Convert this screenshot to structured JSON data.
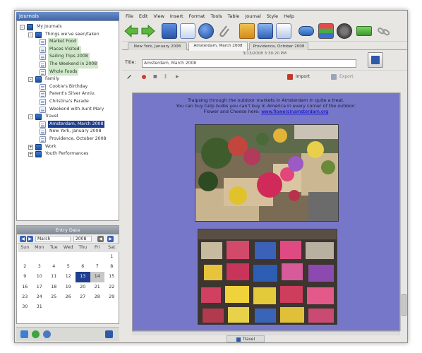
{
  "sidebar": {
    "title": "Journals",
    "tree": [
      {
        "label": "My Journals",
        "depth": 0,
        "icon": "folder-icon",
        "expander": "-"
      },
      {
        "label": "Things we've seen/taken",
        "depth": 1,
        "icon": "journal-book-icon",
        "expander": "-"
      },
      {
        "label": "Market Food",
        "depth": 2,
        "icon": "entry-page-icon",
        "style": "green"
      },
      {
        "label": "Places Visited",
        "depth": 2,
        "icon": "entry-page-icon",
        "style": "green"
      },
      {
        "label": "Sailing Trips 2008",
        "depth": 2,
        "icon": "entry-page-icon",
        "style": "green"
      },
      {
        "label": "The Weekend in 2008",
        "depth": 2,
        "icon": "entry-page-icon",
        "style": "green"
      },
      {
        "label": "Whole Foods",
        "depth": 2,
        "icon": "entry-page-icon",
        "style": "green"
      },
      {
        "label": "Family",
        "depth": 1,
        "icon": "journal-book-icon",
        "expander": "-"
      },
      {
        "label": "Cookie's Birthday",
        "depth": 2,
        "icon": "entry-page-icon"
      },
      {
        "label": "Parent's Silver Anniv.",
        "depth": 2,
        "icon": "entry-page-icon"
      },
      {
        "label": "Christina's Parade",
        "depth": 2,
        "icon": "entry-page-icon"
      },
      {
        "label": "Weekend with Aunt Mary",
        "depth": 2,
        "icon": "entry-page-icon"
      },
      {
        "label": "Travel",
        "depth": 1,
        "icon": "journal-book-icon",
        "expander": "-"
      },
      {
        "label": "Amsterdam, March 2008",
        "depth": 2,
        "icon": "entry-page-icon",
        "style": "selected"
      },
      {
        "label": "New York, January 2008",
        "depth": 2,
        "icon": "entry-page-icon"
      },
      {
        "label": "Providence, October 2008",
        "depth": 2,
        "icon": "entry-page-icon"
      },
      {
        "label": "Work",
        "depth": 1,
        "icon": "journal-book-icon",
        "expander": "+"
      },
      {
        "label": "Youth Performances",
        "depth": 1,
        "icon": "journal-book-icon",
        "expander": "+"
      }
    ]
  },
  "calendar": {
    "title": "Entry Date",
    "month": "March",
    "year": "2008",
    "weekdays": [
      "Sun",
      "Mon",
      "Tue",
      "Wed",
      "Thu",
      "Fri",
      "Sat"
    ],
    "weeks": [
      [
        "",
        "",
        "",
        "",
        "",
        "",
        "1"
      ],
      [
        "2",
        "3",
        "4",
        "5",
        "6",
        "7",
        "8"
      ],
      [
        "9",
        "10",
        "11",
        "12",
        "13",
        "14",
        "15"
      ],
      [
        "16",
        "17",
        "18",
        "19",
        "20",
        "21",
        "22"
      ],
      [
        "23",
        "24",
        "25",
        "26",
        "27",
        "28",
        "29"
      ],
      [
        "30",
        "31",
        "",
        "",
        "",
        "",
        ""
      ]
    ],
    "today": "13",
    "marked": [
      "14"
    ]
  },
  "menu": [
    "File",
    "Edit",
    "View",
    "Insert",
    "Format",
    "Tools",
    "Table",
    "Journal",
    "Style",
    "Help"
  ],
  "tabs": [
    {
      "label": "New York, January 2008",
      "active": false
    },
    {
      "label": "Amsterdam, March 2008",
      "active": true
    },
    {
      "label": "Providence, October 2008",
      "active": false
    }
  ],
  "entry": {
    "date": "3/13/2008 3:30:20 PM",
    "title_label": "Title:",
    "title_value": "Amsterdam, March 2008",
    "import_label": "Import",
    "export_label": "Export"
  },
  "body": {
    "line1": "Traipsing through the outdoor markets in Amsterdam in quite a treat.",
    "line2": "You can buy tulip bulbs you can't buy in America in every corner of the outdoor.",
    "line3_prefix": "Flower and Cheese here:",
    "link": "www.flowersinamsterdam.org"
  },
  "status": {
    "text": "Travel"
  },
  "colors": {
    "content_bg": "#7777c9",
    "selection": "#1f3f8f",
    "window_chrome": "#e7e6e3"
  }
}
